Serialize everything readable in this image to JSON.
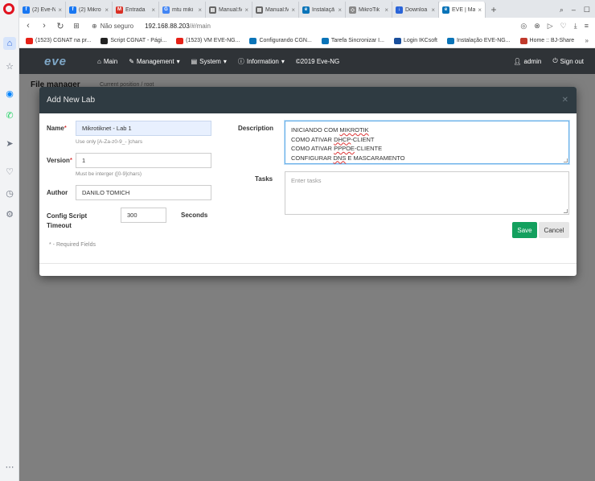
{
  "browser": {
    "tabs": [
      {
        "title": "(2) Eve-N",
        "fav": "f",
        "color": "#1877f2"
      },
      {
        "title": "(2) Mikro",
        "fav": "f",
        "color": "#1877f2"
      },
      {
        "title": "Entrada",
        "fav": "M",
        "color": "#d93025"
      },
      {
        "title": "mtu miki",
        "fav": "G",
        "color": "#4285f4"
      },
      {
        "title": "Manual:M",
        "fav": "▤",
        "color": "#666666"
      },
      {
        "title": "Manual:M",
        "fav": "▤",
        "color": "#666666"
      },
      {
        "title": "Instalaçã",
        "fav": "e",
        "color": "#0a74b8"
      },
      {
        "title": "MikroTik",
        "fav": "◇",
        "color": "#888888"
      },
      {
        "title": "Downloa",
        "fav": "↓",
        "color": "#2a64d8"
      },
      {
        "title": "EVE | Ma",
        "fav": "e",
        "color": "#0a74b8",
        "active": true
      }
    ],
    "new_tab": "+",
    "address": {
      "secure_label": "Não seguro",
      "host": "192.168.88.203",
      "path": "/#/main"
    },
    "bookmarks": [
      {
        "label": "(1523) CGNAT na pr...",
        "type": "yt"
      },
      {
        "label": "Script CGNAT - Pági...",
        "type": "mk"
      },
      {
        "label": "(1523) VM EVE-NG...",
        "type": "yt"
      },
      {
        "label": "Configurando CGN...",
        "type": "eve"
      },
      {
        "label": "Tarefa Sincronizar I...",
        "type": "eve"
      },
      {
        "label": "Login IKCsoft",
        "type": "ik"
      },
      {
        "label": "Instalação EVE-NG...",
        "type": "eve"
      },
      {
        "label": "Home :: BJ-Share",
        "type": "bj"
      }
    ],
    "bookmarks_more": "»"
  },
  "eve_nav": {
    "logo": "eve",
    "items": [
      {
        "label": "Main",
        "icon": "home-icon",
        "glyph": "⌂",
        "caret": ""
      },
      {
        "label": "Management",
        "icon": "wrench-icon",
        "glyph": "✎",
        "caret": "▾"
      },
      {
        "label": "System",
        "icon": "server-icon",
        "glyph": "▤",
        "caret": "▾"
      },
      {
        "label": "Information",
        "icon": "info-icon",
        "glyph": "ⓘ",
        "caret": "▾"
      },
      {
        "label": "©2019 Eve-NG",
        "icon": "",
        "glyph": "",
        "caret": ""
      }
    ],
    "user": "admin",
    "signout": "Sign out"
  },
  "page": {
    "title": "File manager",
    "crumb": "Current position   /   root"
  },
  "modal": {
    "title": "Add New Lab",
    "name_label": "Name",
    "name_value": "Mikrotiknet - Lab 1",
    "name_hint": "Use only [A-Za-z0-9_- ]chars",
    "version_label": "Version",
    "version_value": "1",
    "version_hint": "Must be interger ([0-9]chars)",
    "author_label": "Author",
    "author_value": "DANILO TOMICH",
    "config_label_1": "Config Script",
    "config_label_2": "Timeout",
    "config_value": "300",
    "seconds_label": "Seconds",
    "required_note": "* - Required Fields",
    "description_label": "Description",
    "description_lines": [
      {
        "pre": "INICIANDO COM ",
        "sp": "MIKROTIK",
        "post": ""
      },
      {
        "pre": "COMO ATIVAR ",
        "sp": "DHCP",
        "post": "-CLIENT"
      },
      {
        "pre": "COMO ATIVAR ",
        "sp": "PPPOE",
        "post": "-CLIENTE"
      },
      {
        "pre": "CONFIGURAR ",
        "sp": "DNS",
        "post": " E MASCARAMENTO"
      }
    ],
    "tasks_label": "Tasks",
    "tasks_placeholder": "Enter tasks",
    "save_label": "Save",
    "cancel_label": "Cancel"
  }
}
